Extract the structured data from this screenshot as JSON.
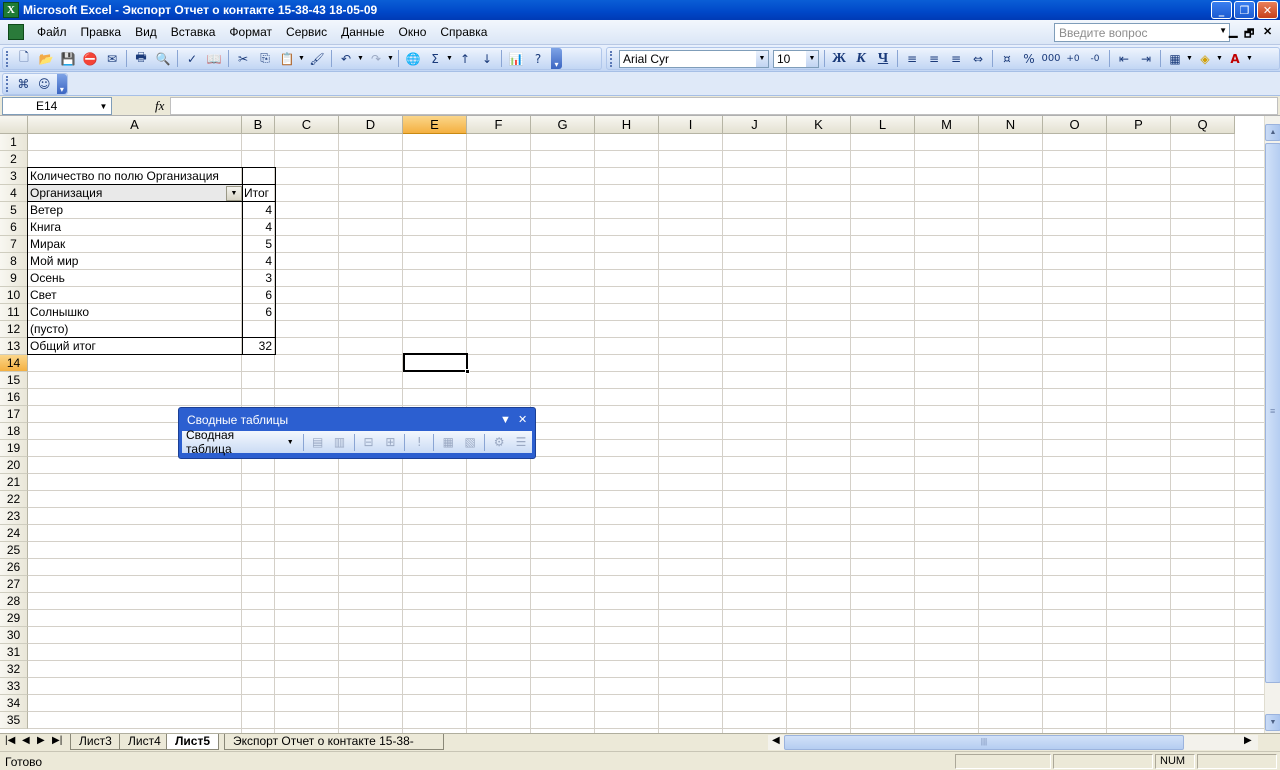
{
  "window": {
    "title": "Microsoft Excel - Экспорт Отчет о контакте 15-38-43 18-05-09",
    "controls": [
      "_",
      "❐",
      "✕"
    ]
  },
  "menu": {
    "items": [
      "Файл",
      "Правка",
      "Вид",
      "Вставка",
      "Формат",
      "Сервис",
      "Данные",
      "Окно",
      "Справка"
    ],
    "help_placeholder": "Введите вопрос",
    "doc_controls": [
      "▁",
      "🗗",
      "✕"
    ]
  },
  "toolbar": {
    "font_name": "Arial Cyr",
    "font_size": "10",
    "bold": "Ж",
    "italic": "К",
    "underline": "Ч",
    "percent": "%",
    "thousands": "000",
    "sigma": "Σ"
  },
  "formula_bar": {
    "name_box": "E14",
    "fx_label": "fx",
    "content": ""
  },
  "grid": {
    "columns": [
      "A",
      "B",
      "C",
      "D",
      "E",
      "F",
      "G",
      "H",
      "I",
      "J",
      "K",
      "L",
      "M",
      "N",
      "O",
      "P",
      "Q"
    ],
    "rows": [
      "1",
      "2",
      "3",
      "4",
      "5",
      "6",
      "7",
      "8",
      "9",
      "10",
      "11",
      "12",
      "13",
      "14",
      "15",
      "16",
      "17",
      "18",
      "19",
      "20",
      "21",
      "22",
      "23",
      "24",
      "25",
      "26",
      "27",
      "28",
      "29",
      "30",
      "31",
      "32",
      "33",
      "34",
      "35"
    ],
    "selected_column": "E",
    "selected_row": "14"
  },
  "pivot": {
    "header": "Количество по полю Организация",
    "row_field": "Организация",
    "total_header": "Итог",
    "rows": [
      {
        "label": "Ветер",
        "value": "4"
      },
      {
        "label": "Книга",
        "value": "4"
      },
      {
        "label": "Мирак",
        "value": "5"
      },
      {
        "label": "Мой мир",
        "value": "4"
      },
      {
        "label": "Осень",
        "value": "3"
      },
      {
        "label": "Свет",
        "value": "6"
      },
      {
        "label": "Солнышко",
        "value": "6"
      },
      {
        "label": "(пусто)",
        "value": ""
      }
    ],
    "grand_total_label": "Общий итог",
    "grand_total_value": "32"
  },
  "pivot_toolbar": {
    "title": "Сводные таблицы",
    "menu_label": "Сводная таблица"
  },
  "sheets": {
    "tabs": [
      "Лист3",
      "Лист4",
      "Лист5",
      "Экспорт Отчет о контакте 15-38-"
    ],
    "active": "Лист5"
  },
  "status": {
    "text": "Готово",
    "num_indicator": "NUM"
  },
  "colors": {
    "title_bar": "#0047c8",
    "selection_header": "#f4b041",
    "pivot_toolbar": "#2c5fd0"
  }
}
